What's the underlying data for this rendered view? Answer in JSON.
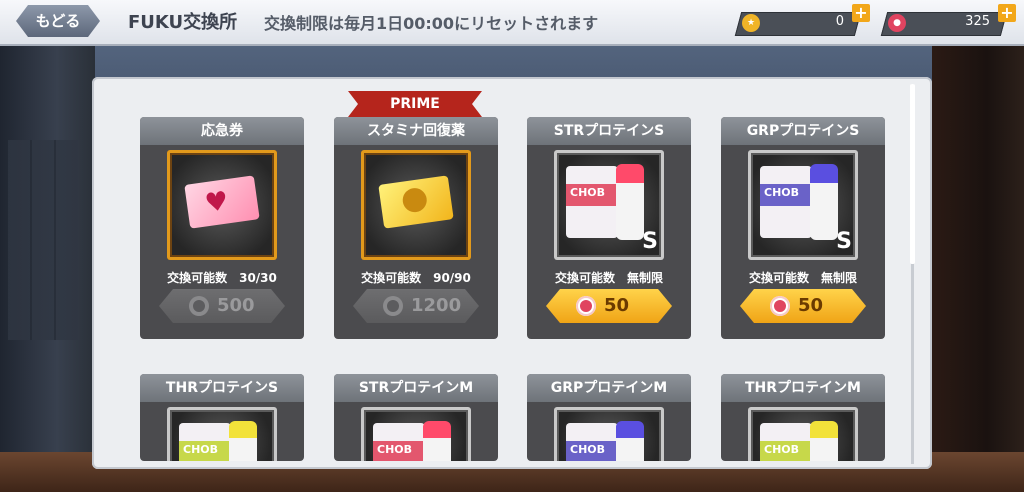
{
  "topbar": {
    "back_label": "もどる",
    "title": "FUKU交換所",
    "subtitle": "交換制限は毎月1日00:00にリセットされます",
    "currencies": [
      {
        "icon": "gold-coin-icon",
        "value": "0",
        "color": "#f0b427"
      },
      {
        "icon": "fuku-coin-icon",
        "value": "325",
        "color": "#e04460"
      }
    ]
  },
  "badge": {
    "prime_label": "PRIME"
  },
  "items": [
    {
      "name": "応急券",
      "count": "交換可能数　30/30",
      "price": "500",
      "enabled": false,
      "art": "heart-ticket-icon"
    },
    {
      "name": "スタミナ回復薬",
      "count": "交換可能数　90/90",
      "price": "1200",
      "enabled": false,
      "art": "stamina-ticket-icon"
    },
    {
      "name": "STRプロテインS",
      "count": "交換可能数　無制限",
      "price": "50",
      "enabled": true,
      "art": "protein-str-icon"
    },
    {
      "name": "GRPプロテインS",
      "count": "交換可能数　無制限",
      "price": "50",
      "enabled": true,
      "art": "protein-grp-icon"
    },
    {
      "name": "THRプロテインS",
      "art": "protein-thr-icon"
    },
    {
      "name": "STRプロテインM",
      "art": "protein-str-icon"
    },
    {
      "name": "GRPプロテインM",
      "art": "protein-grp-icon"
    },
    {
      "name": "THRプロテインM",
      "art": "protein-thr-icon"
    }
  ],
  "protein_labels": {
    "brand": "CHOB",
    "s": "S"
  }
}
